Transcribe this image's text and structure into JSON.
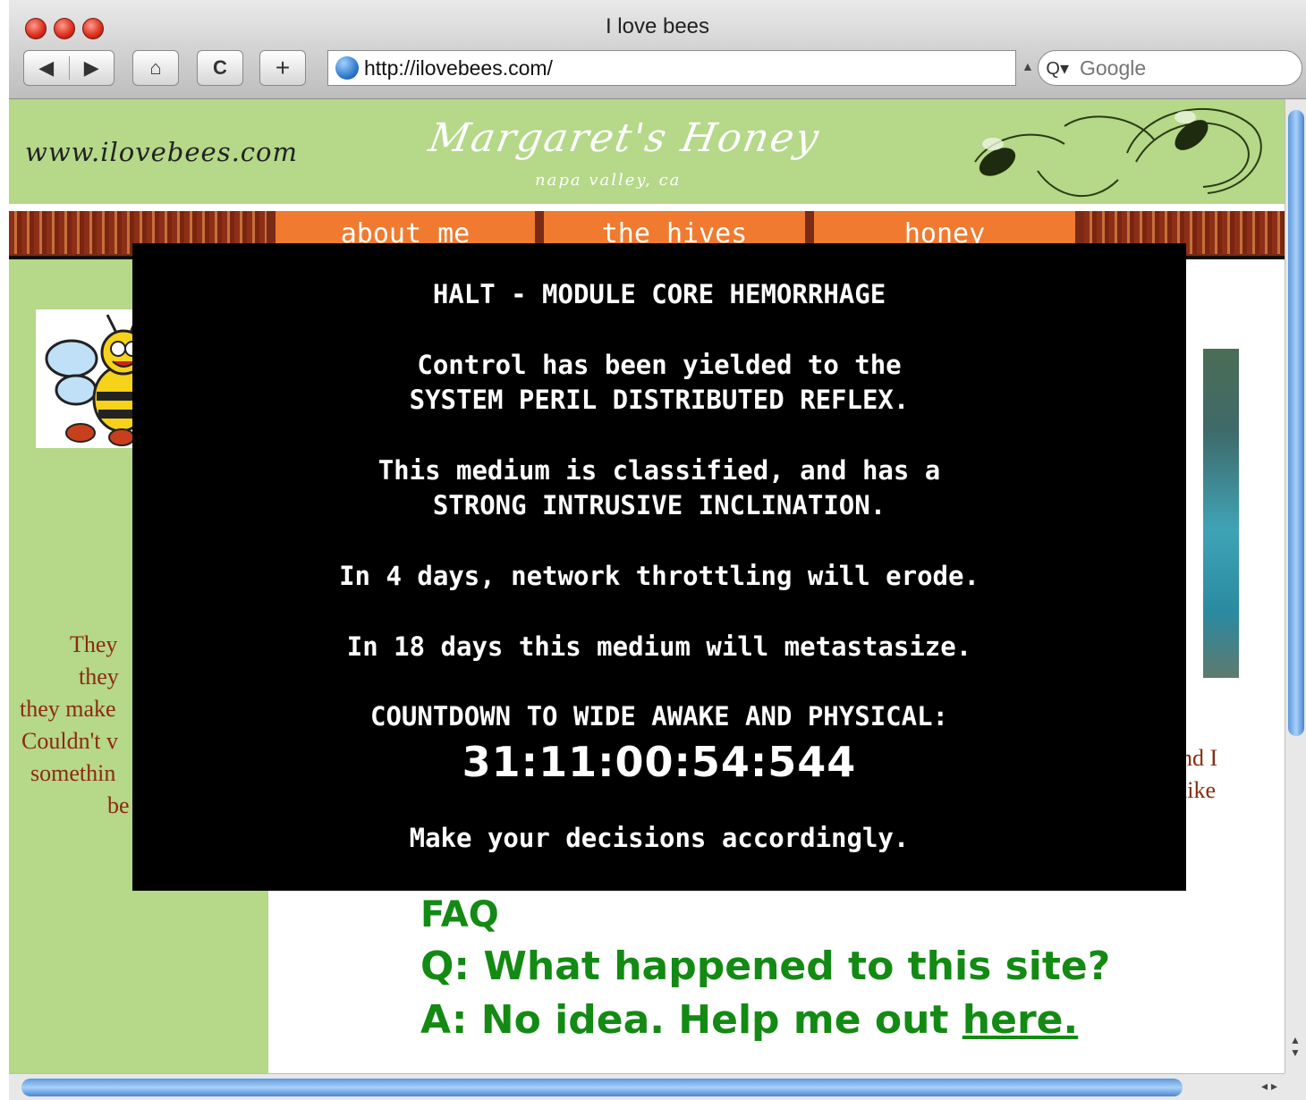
{
  "window": {
    "title": "I love bees"
  },
  "toolbar": {
    "back_label": "◀",
    "forward_label": "▶",
    "home_label": "⌂",
    "reload_label": "C",
    "add_label": "+",
    "url": "http://ilovebees.com/",
    "search_placeholder": "Google"
  },
  "header": {
    "site_url": "www.ilovebees.com",
    "brand": "Margaret's Honey",
    "brand_sub": "napa valley, ca"
  },
  "nav": {
    "items": [
      {
        "label": "about me"
      },
      {
        "label": "the hives"
      },
      {
        "label": "honey"
      }
    ]
  },
  "sidebar": {
    "text_lines": [
      "They",
      "they",
      "they make",
      "Couldn't v",
      "somethin",
      "be"
    ]
  },
  "content": {
    "right_text_lines": [
      "nd I",
      "like",
      "."
    ]
  },
  "overlay": {
    "line1": "HALT - MODULE CORE HEMORRHAGE",
    "line2": "Control has been yielded to the",
    "line3": "SYSTEM PERIL DISTRIBUTED REFLEX.",
    "line4": "This medium is classified, and has a",
    "line5": "STRONG INTRUSIVE INCLINATION.",
    "line6": "In 4 days, network throttling will erode.",
    "line7": "In 18 days this medium will metastasize.",
    "line8": "COUNTDOWN TO WIDE AWAKE AND PHYSICAL:",
    "countdown": "31:11:00:54:544",
    "line9": "Make your decisions accordingly."
  },
  "faq": {
    "title": "FAQ",
    "question": "Q: What happened to this site?",
    "answer_prefix": "A: No idea. Help me out ",
    "answer_link": "here."
  },
  "colors": {
    "banner_green": "#b5d889",
    "nav_orange": "#f07a2f",
    "faq_green": "#138a13",
    "side_text_red": "#8c2a10"
  }
}
